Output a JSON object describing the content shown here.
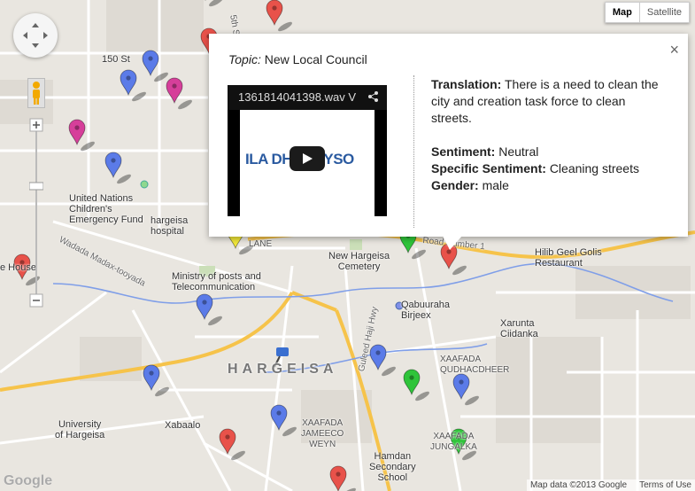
{
  "map_type": {
    "map": "Map",
    "satellite": "Satellite"
  },
  "popup": {
    "topic_label": "Topic:",
    "topic_value": "New Local Council",
    "close": "×",
    "video_title": "1361814041398.wav V",
    "video_logo": "ILA DHAGEYSO",
    "translation_label": "Translation:",
    "translation_value": "There is a need to clean the city and creation task force to clean streets.",
    "sentiment_label": "Sentiment:",
    "sentiment_value": "Neutral",
    "specific_label": "Specific Sentiment:",
    "specific_value": "Cleaning streets",
    "gender_label": "Gender:",
    "gender_value": "male"
  },
  "labels": {
    "street_150": "150 St",
    "street_5th": "5th S",
    "unicef": "United Nations\nChildren's\nEmergency Fund",
    "hospital": "hargeisa\nhospital",
    "house": "e House",
    "wadada": "Wadada Madax-tooyada",
    "ministry": "Ministry of posts and\nTelecommunication",
    "lane": "LANE",
    "new_hargeisa": "New Hargeisa\nCemetery",
    "road_number": "Road Number 1",
    "hilib": "Hilib Geel Golis\nRestaurant",
    "qabuuraha": "Qabuuraha\nBirjeex",
    "xarunta": "Xarunta\nCiidanka",
    "xaafada_q": "XAAFADA\nQUDHACDHEER",
    "hargeisa": "HARGEISA",
    "guleed": "Guleed Haji Hwy",
    "university": "University\nof Hargeisa",
    "xabaalo": "Xabaalo",
    "xaafada_j": "XAAFADA\nJAMEECO\nWEYN",
    "hamdan": "Hamdan\nSecondary\nSchool",
    "xaafada_jungal": "XAAFADA\nJUNGALKA"
  },
  "footer": {
    "map_data": "Map data ©2013 Google",
    "terms": "Terms of Use",
    "google": "Google"
  },
  "colors": {
    "red": "#e8524a",
    "blue": "#5b7be8",
    "green": "#2fc43a",
    "magenta": "#d63f9a",
    "yellow": "#f2e83a",
    "orange": "#f5a623",
    "road_yellow": "#f6c34a",
    "river": "#7f9ee8"
  },
  "markers": [
    {
      "color": "orange"
    },
    {
      "color": "red"
    },
    {
      "color": "red"
    },
    {
      "color": "blue"
    },
    {
      "color": "blue"
    },
    {
      "color": "magenta"
    },
    {
      "color": "magenta"
    },
    {
      "color": "blue"
    },
    {
      "color": "red"
    },
    {
      "color": "yellow"
    },
    {
      "color": "green"
    },
    {
      "color": "red"
    },
    {
      "color": "blue"
    },
    {
      "color": "blue"
    },
    {
      "color": "blue"
    },
    {
      "color": "green"
    },
    {
      "color": "blue"
    },
    {
      "color": "blue"
    },
    {
      "color": "red"
    },
    {
      "color": "green"
    },
    {
      "color": "red"
    }
  ]
}
